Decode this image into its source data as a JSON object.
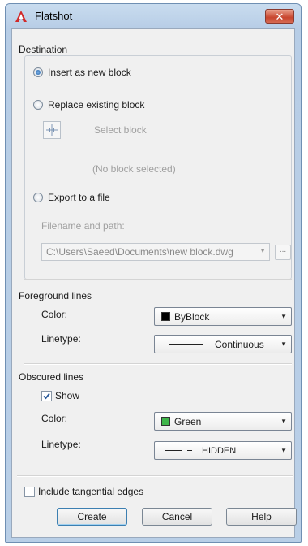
{
  "window": {
    "title": "Flatshot",
    "close_label": "✕"
  },
  "destination": {
    "title": "Destination",
    "insert_label": "Insert as new block",
    "replace_label": "Replace existing block",
    "select_block_label": "Select block",
    "no_block_label": "(No block selected)",
    "export_label": "Export to a file",
    "filename_label": "Filename and path:",
    "filename_value": "C:\\Users\\Saeed\\Documents\\new block.dwg",
    "browse_label": "..."
  },
  "foreground": {
    "title": "Foreground lines",
    "color_label": "Color:",
    "color_value": "ByBlock",
    "color_swatch": "#000000",
    "linetype_label": "Linetype:",
    "linetype_value": "Continuous"
  },
  "obscured": {
    "title": "Obscured lines",
    "show_label": "Show",
    "show_checked": true,
    "color_label": "Color:",
    "color_value": "Green",
    "color_swatch": "#3fb54a",
    "linetype_label": "Linetype:",
    "linetype_value": "HIDDEN"
  },
  "tangential": {
    "label": "Include tangential edges",
    "checked": false
  },
  "buttons": {
    "create": "Create",
    "cancel": "Cancel",
    "help": "Help"
  }
}
